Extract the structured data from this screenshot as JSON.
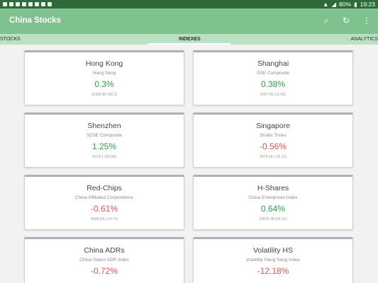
{
  "status": {
    "battery": "80%",
    "time": "19:23"
  },
  "app": {
    "title": "China Stocks",
    "icons": [
      "search-icon",
      "refresh-icon",
      "overflow-menu-icon"
    ]
  },
  "tabs": [
    {
      "label": "STOCKS"
    },
    {
      "label": "INDEXES"
    },
    {
      "label": "ANALYTICS"
    }
  ],
  "cards": [
    {
      "name": "Hong Kong",
      "sub": "Hang Seng",
      "change": "0.3%",
      "detail": "31920.80 (66.2)",
      "direction": "up"
    },
    {
      "name": "Shanghai",
      "sub": "SSE Composite",
      "change": "0.38%",
      "detail": "3097.02 (11.66)",
      "direction": "up"
    },
    {
      "name": "Shenzhen",
      "sub": "SZSE Composite",
      "change": "1.25%",
      "detail": "1679.1 (20.68)",
      "direction": "up"
    },
    {
      "name": "Singapore",
      "sub": "Straits Times",
      "change": "-0.56%",
      "detail": "2879.54 (-16.22)",
      "direction": "down"
    },
    {
      "name": "Red-Chips",
      "sub": "China Affiliated Corporations",
      "change": "-0.61%",
      "detail": "4048.53 (-24.71)",
      "direction": "down"
    },
    {
      "name": "H-Shares",
      "sub": "China Enterprises Index",
      "change": "0.64%",
      "detail": "10028.38 (64.21)",
      "direction": "up"
    },
    {
      "name": "China ADRs",
      "sub": "China Select ADR Index",
      "change": "-0.72%",
      "detail": "",
      "direction": "down"
    },
    {
      "name": "Volatility HS",
      "sub": "Volatility Hang Seng Index",
      "change": "-12.18%",
      "detail": "",
      "direction": "down"
    }
  ],
  "colors": {
    "status_bar": "#2f6b3a",
    "app_bar": "#7fc18f",
    "tabs_bar": "#b8e2c2",
    "positive": "#2ea04c",
    "negative": "#e0534f"
  }
}
